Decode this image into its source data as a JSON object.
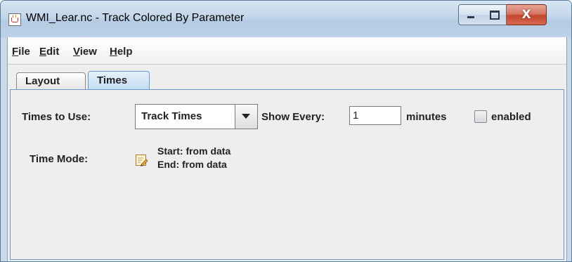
{
  "window": {
    "title": "WMI_Lear.nc - Track Colored By Parameter",
    "close_glyph": "X",
    "icon": "java-cup-icon"
  },
  "menu": {
    "items": [
      "File",
      "Edit",
      "View",
      "Help"
    ]
  },
  "tabs": [
    {
      "label": "Layout",
      "selected": false
    },
    {
      "label": "Times",
      "selected": true
    }
  ],
  "times": {
    "times_to_use_label": "Times to Use:",
    "times_to_use_value": "Track Times",
    "show_every_label": "Show Every:",
    "show_every_value": "1",
    "minutes_label": "minutes",
    "enabled_label": "enabled",
    "enabled_checked": false,
    "time_mode_label": "Time Mode:",
    "start_text": "Start: from data",
    "end_text": "End: from data"
  },
  "colors": {
    "tab_selected": "#c2dbf2",
    "panel_border": "#6e98c5",
    "close_button": "#c4462d"
  }
}
